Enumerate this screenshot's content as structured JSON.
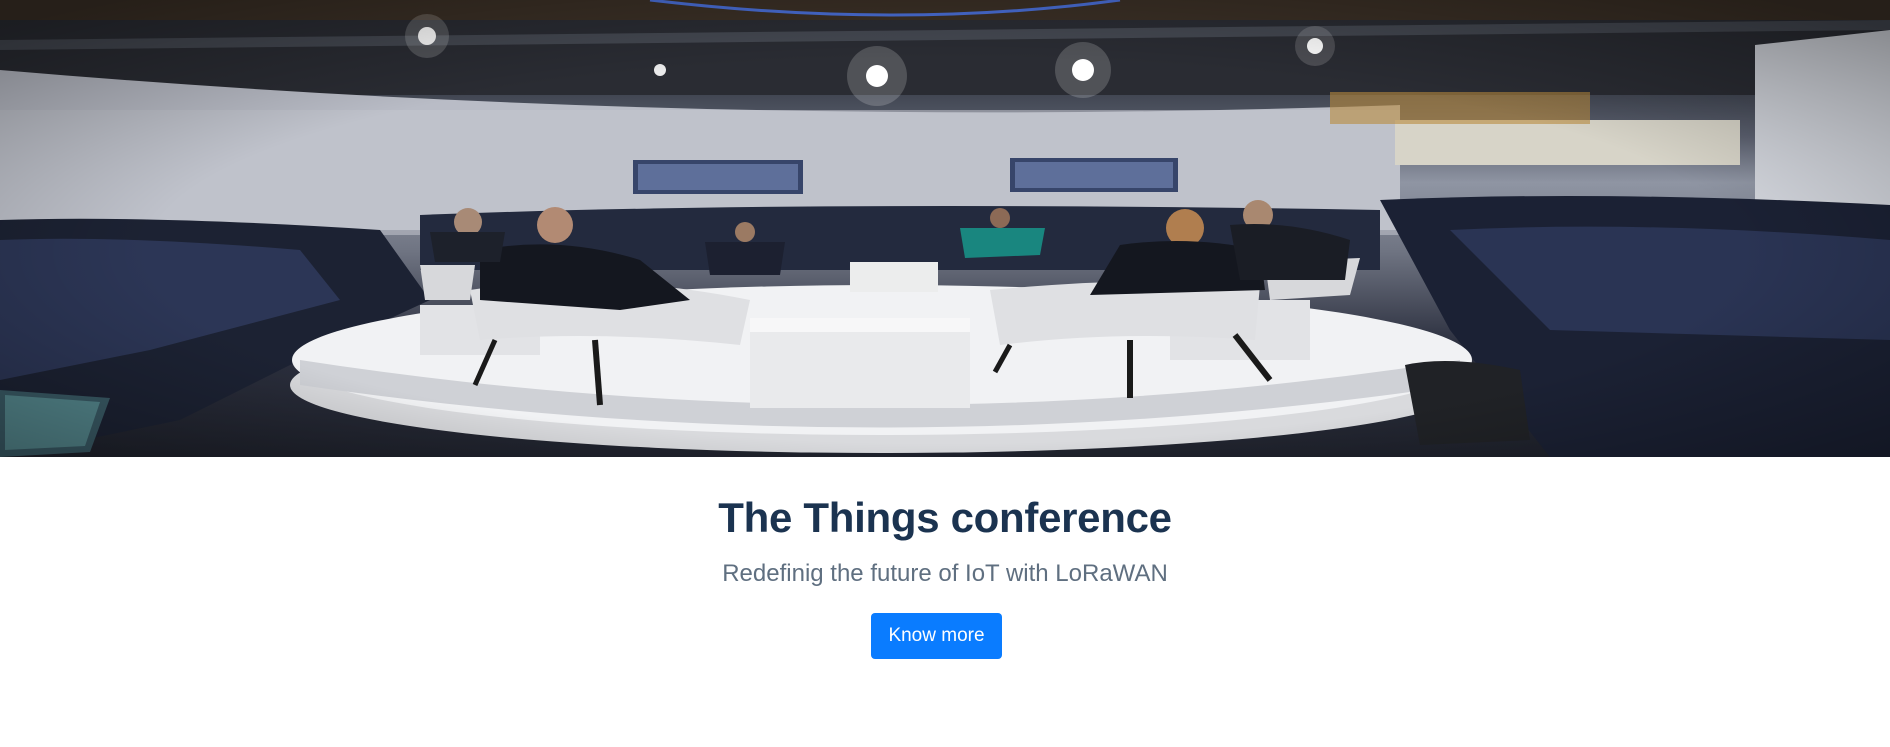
{
  "hero": {
    "image_name": "conference-panel-photo"
  },
  "content": {
    "title": "The Things conference",
    "subtitle": "Redefinig the future of IoT with LoRaWAN",
    "button_label": "Know more"
  },
  "colors": {
    "title": "#1b3350",
    "subtitle": "#5f6f80",
    "button_bg": "#0a7cff",
    "button_text": "#ffffff"
  }
}
